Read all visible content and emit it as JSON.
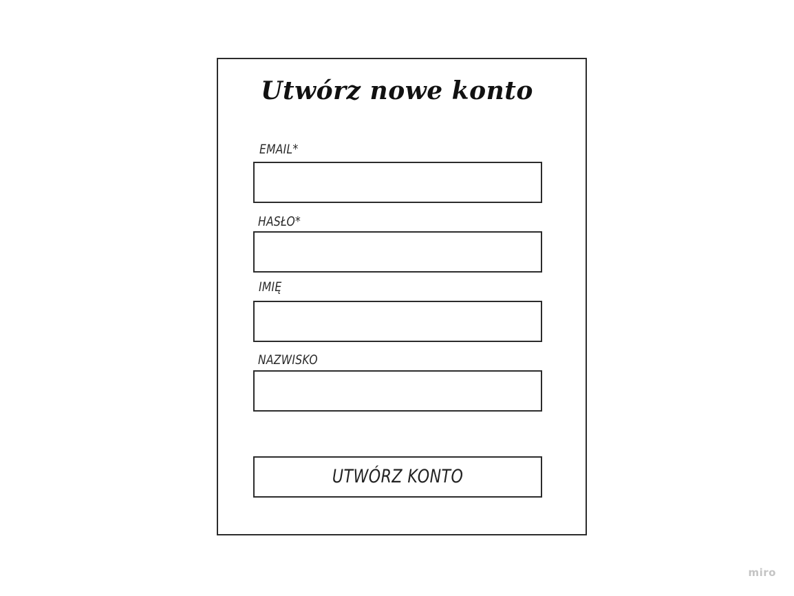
{
  "form": {
    "title": "Utwórz nowe konto",
    "fields": [
      {
        "label": "EMAIL*",
        "value": "",
        "placeholder": ""
      },
      {
        "label": "HASŁO*",
        "value": "",
        "placeholder": ""
      },
      {
        "label": "IMIĘ",
        "value": "",
        "placeholder": ""
      },
      {
        "label": "NAZWISKO",
        "value": "",
        "placeholder": ""
      }
    ],
    "submit_label": "UTWÓRZ KONTO"
  },
  "watermark": "miro"
}
